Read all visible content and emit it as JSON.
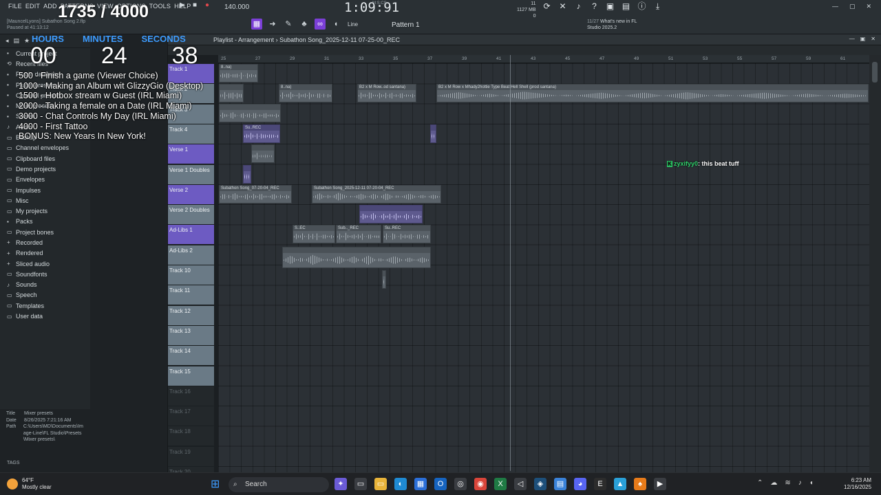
{
  "menu": [
    "FILE",
    "EDIT",
    "ADD",
    "PATTERNS",
    "VIEW",
    "OPTIONS",
    "TOOLS",
    "HELP"
  ],
  "project": {
    "name": "[MauncelLyons] Subathon Song 2.flp",
    "status": "Paused at 41:13:12"
  },
  "tempo": "140.000",
  "time_display": "1:09:91",
  "time_sub": "M:S:CS",
  "perf": {
    "cpu": "11",
    "memory": "1127 MB",
    "voices": "0"
  },
  "snap": "Line",
  "pattern": "Pattern 1",
  "news": {
    "line1": "11/27",
    "line2": "What's new in FL",
    "line3": "Studio 2025.2"
  },
  "browser": {
    "items": [
      {
        "icon": "▪",
        "label": "Current project"
      },
      {
        "icon": "⟲",
        "label": "Recent files"
      },
      {
        "icon": "▪",
        "label": "Plugin database"
      },
      {
        "icon": "▪",
        "label": "Plugin presets"
      },
      {
        "icon": "▪",
        "label": "Channel presets"
      },
      {
        "icon": "▪",
        "label": "Mixer presets"
      },
      {
        "icon": "▪",
        "label": "Scores"
      },
      {
        "icon": "♪",
        "label": "Audio"
      },
      {
        "icon": "▭",
        "label": "Backup"
      },
      {
        "icon": "▭",
        "label": "Channel envelopes"
      },
      {
        "icon": "▭",
        "label": "Clipboard files"
      },
      {
        "icon": "▭",
        "label": "Demo projects"
      },
      {
        "icon": "▭",
        "label": "Envelopes"
      },
      {
        "icon": "▭",
        "label": "Impulses"
      },
      {
        "icon": "▭",
        "label": "Misc"
      },
      {
        "icon": "▭",
        "label": "My projects"
      },
      {
        "icon": "▪",
        "label": "Packs"
      },
      {
        "icon": "▭",
        "label": "Project bones"
      },
      {
        "icon": "+",
        "label": "Recorded"
      },
      {
        "icon": "+",
        "label": "Rendered"
      },
      {
        "icon": "+",
        "label": "Sliced audio"
      },
      {
        "icon": "▭",
        "label": "Soundfonts"
      },
      {
        "icon": "♪",
        "label": "Sounds"
      },
      {
        "icon": "▭",
        "label": "Speech"
      },
      {
        "icon": "▭",
        "label": "Templates"
      },
      {
        "icon": "▭",
        "label": "User data"
      }
    ],
    "info": {
      "title_label": "Title",
      "title": "Mixer presets",
      "date_label": "Date",
      "date": "8/26/2025 7:21:16 AM",
      "path_label": "Path",
      "path": "C:\\Users\\MD\\Documents\\Image-Line\\FL Studio\\Presets\\Mixer presets\\"
    },
    "tags": "TAGS"
  },
  "playlist": {
    "title": "Playlist - Arrangement",
    "separator": "›",
    "clip_name": "Subathon Song_2025-12-11 07-25-00_REC",
    "timeline": [
      "25",
      "27",
      "29",
      "31",
      "33",
      "35",
      "37",
      "39",
      "41",
      "43",
      "45",
      "47",
      "49",
      "51",
      "53",
      "55",
      "57",
      "59",
      "61",
      "62"
    ],
    "tracks": [
      {
        "name": "Track 1",
        "style": "purple"
      },
      {
        "name": "Track 2",
        "style": "slate"
      },
      {
        "name": "Track 3",
        "style": "slate"
      },
      {
        "name": "Track 4",
        "style": "slate"
      },
      {
        "name": "Verse 1",
        "style": "purple"
      },
      {
        "name": "Verse 1 Doubles",
        "style": "slate"
      },
      {
        "name": "Verse 2",
        "style": "purple"
      },
      {
        "name": "Verse 2 Doubles",
        "style": "slate"
      },
      {
        "name": "Ad-Libs 1",
        "style": "purple"
      },
      {
        "name": "Ad-Libs 2",
        "style": "slate"
      },
      {
        "name": "Track 10",
        "style": "slate"
      },
      {
        "name": "Track 11",
        "style": "slate"
      },
      {
        "name": "Track 12",
        "style": "slate"
      },
      {
        "name": "Track 13",
        "style": "slate"
      },
      {
        "name": "Track 14",
        "style": "slate"
      },
      {
        "name": "Track 15",
        "style": "slate"
      },
      {
        "name": "Track 16",
        "style": "dark"
      },
      {
        "name": "Track 17",
        "style": "dark"
      },
      {
        "name": "Track 18",
        "style": "dark"
      },
      {
        "name": "Track 19",
        "style": "dark"
      },
      {
        "name": "Track 20",
        "style": "dark"
      }
    ],
    "clips": {
      "c1": "8..na)",
      "c2": "8..na)",
      "c3": "B2 x M Row..od santana)",
      "c4": "B2 x M Row x Mhady2hottie Type Beat Hell Shell (prod santana)",
      "c5": "Su..REC",
      "c6": "Subathon Song_07-20-04_REC",
      "c7": "Subathon Song_2025-12-11 07-20-04_REC",
      "c8": "S..EC",
      "c9": "Sub.._REC",
      "c10": "Su..REC"
    }
  },
  "overlay": {
    "count": "1735 / 4000",
    "labels": {
      "hours": "HOURS",
      "minutes": "MINUTES",
      "seconds": "SECONDS"
    },
    "timer": {
      "hours": "00",
      "minutes": "24",
      "seconds": "38"
    },
    "goals": [
      "500 - Finish a game (Viewer Choice)",
      "1000 - Making an Album wit GlizzyGio (Desktop)",
      "1500 - Hotbox stream w Guest (IRL Miami)",
      "2000 - Taking a female on a Date (IRL Miami)",
      "3000 - Chat Controls My Day (IRL Miami)",
      "4000 - First Tattoo",
      "BONUS: New Years In New York!"
    ]
  },
  "chat": {
    "user": "zyxifyy0",
    "message": ": this beat tuff",
    "user_color": "#2fd16a"
  },
  "taskbar": {
    "weather": {
      "temp": "64°F",
      "desc": "Mostly clear"
    },
    "search": "Search",
    "time": "6:23 AM",
    "date": "12/16/2025"
  }
}
